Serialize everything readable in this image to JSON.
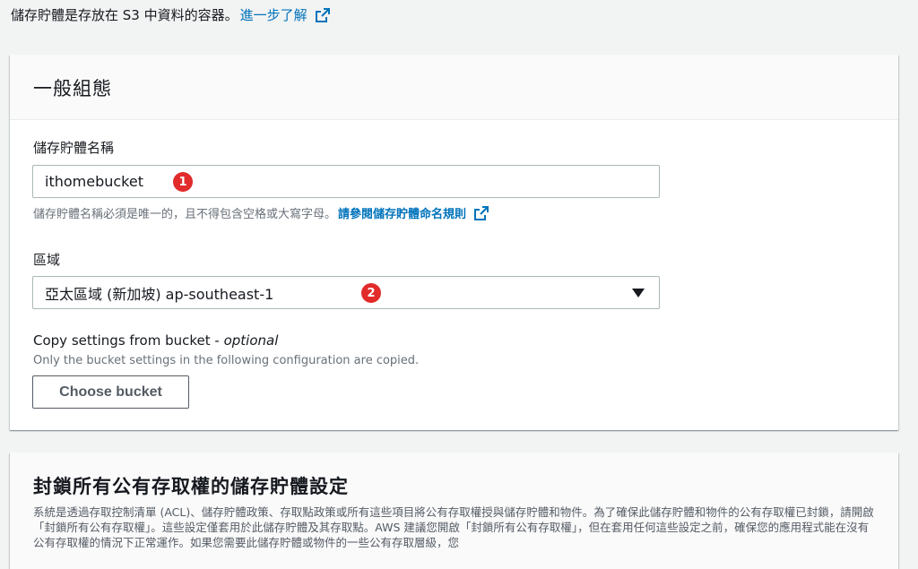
{
  "intro": {
    "text": "儲存貯體是存放在 S3 中資料的容器。",
    "link": "進一步了解"
  },
  "general": {
    "title": "一般組態",
    "bucket_name": {
      "label": "儲存貯體名稱",
      "value": "ithomebucket",
      "badge": "1",
      "hint": "儲存貯體名稱必須是唯一的，且不得包含空格或大寫字母。",
      "hint_link": "請參閱儲存貯體命名規則"
    },
    "region": {
      "label": "區域",
      "value": "亞太區域 (新加坡) ap-southeast-1",
      "badge": "2"
    },
    "copy": {
      "label": "Copy settings from bucket - ",
      "label_optional": "optional",
      "desc": "Only the bucket settings in the following configuration are copied.",
      "button": "Choose bucket"
    }
  },
  "block_public": {
    "title": "封鎖所有公有存取權的儲存貯體設定",
    "desc": "系統是透過存取控制清單 (ACL)、儲存貯體政策、存取點政策或所有這些項目將公有存取權授與儲存貯體和物件。為了確保此儲存貯體和物件的公有存取權已封鎖，請開啟「封鎖所有公有存取權」。這些設定僅套用於此儲存貯體及其存取點。AWS 建議您開啟「封鎖所有公有存取權」，但在套用任何這些設定之前，確保您的應用程式能在沒有公有存取權的情況下正常運作。如果您需要此儲存貯體或物件的一些公有存取層級，您"
  }
}
